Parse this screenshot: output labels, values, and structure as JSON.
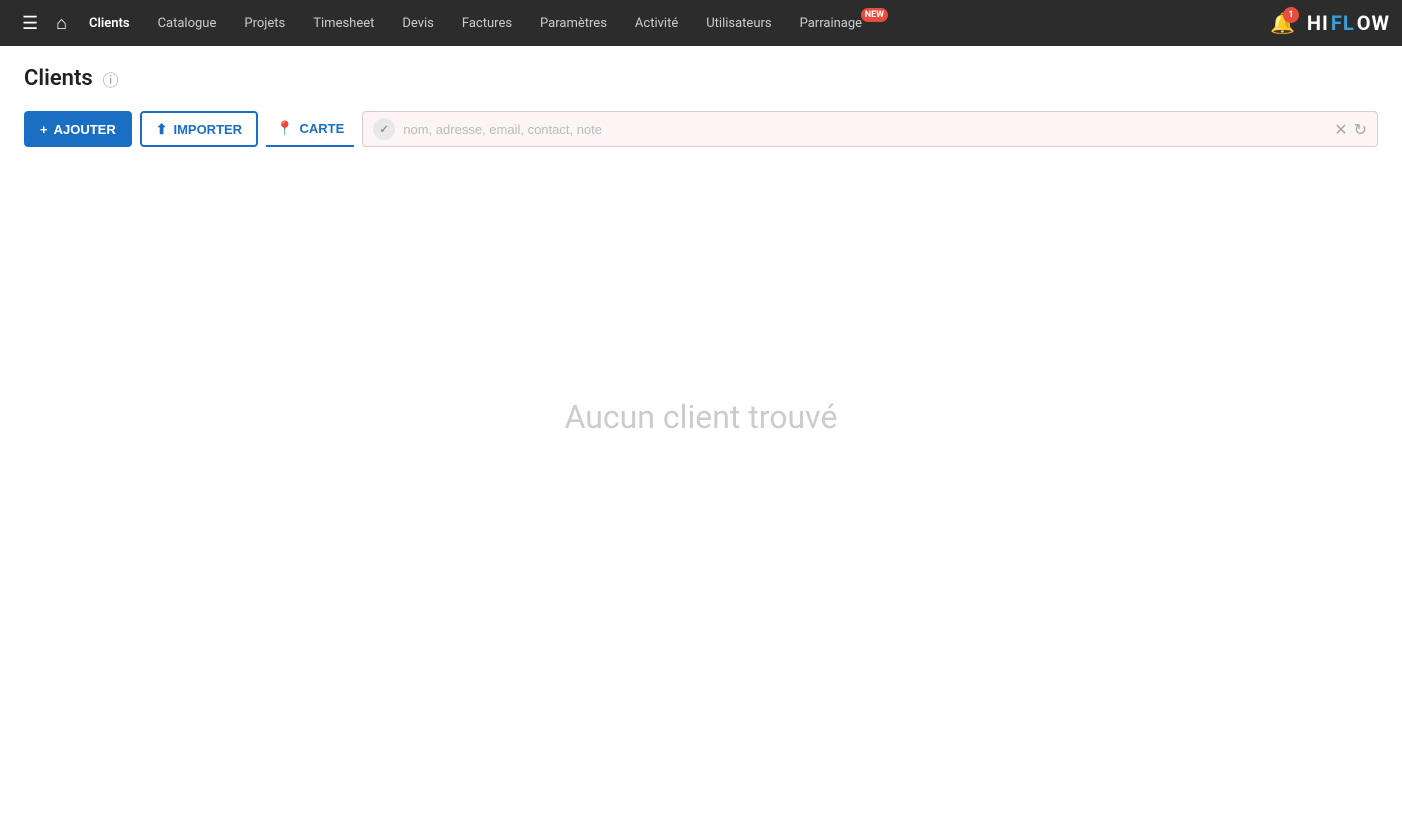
{
  "nav": {
    "hamburger_title": "Menu",
    "home_title": "Accueil",
    "items": [
      {
        "label": "Clients",
        "active": true
      },
      {
        "label": "Catalogue",
        "active": false
      },
      {
        "label": "Projets",
        "active": false
      },
      {
        "label": "Timesheet",
        "active": false
      },
      {
        "label": "Devis",
        "active": false
      },
      {
        "label": "Factures",
        "active": false
      },
      {
        "label": "Paramètres",
        "active": false
      },
      {
        "label": "Activité",
        "active": false
      },
      {
        "label": "Utilisateurs",
        "active": false
      },
      {
        "label": "Parrainage",
        "active": false,
        "badge": "NEW"
      }
    ],
    "notification_count": "1",
    "logo_hi": "HI",
    "logo_fl": "FL",
    "logo_ow": "OW"
  },
  "page": {
    "title": "Clients"
  },
  "toolbar": {
    "add_label": "AJOUTER",
    "import_label": "IMPORTER",
    "carte_label": "CARTE"
  },
  "search": {
    "placeholder": "nom, adresse, email, contact, note"
  },
  "main": {
    "empty_message": "Aucun client trouvé"
  }
}
